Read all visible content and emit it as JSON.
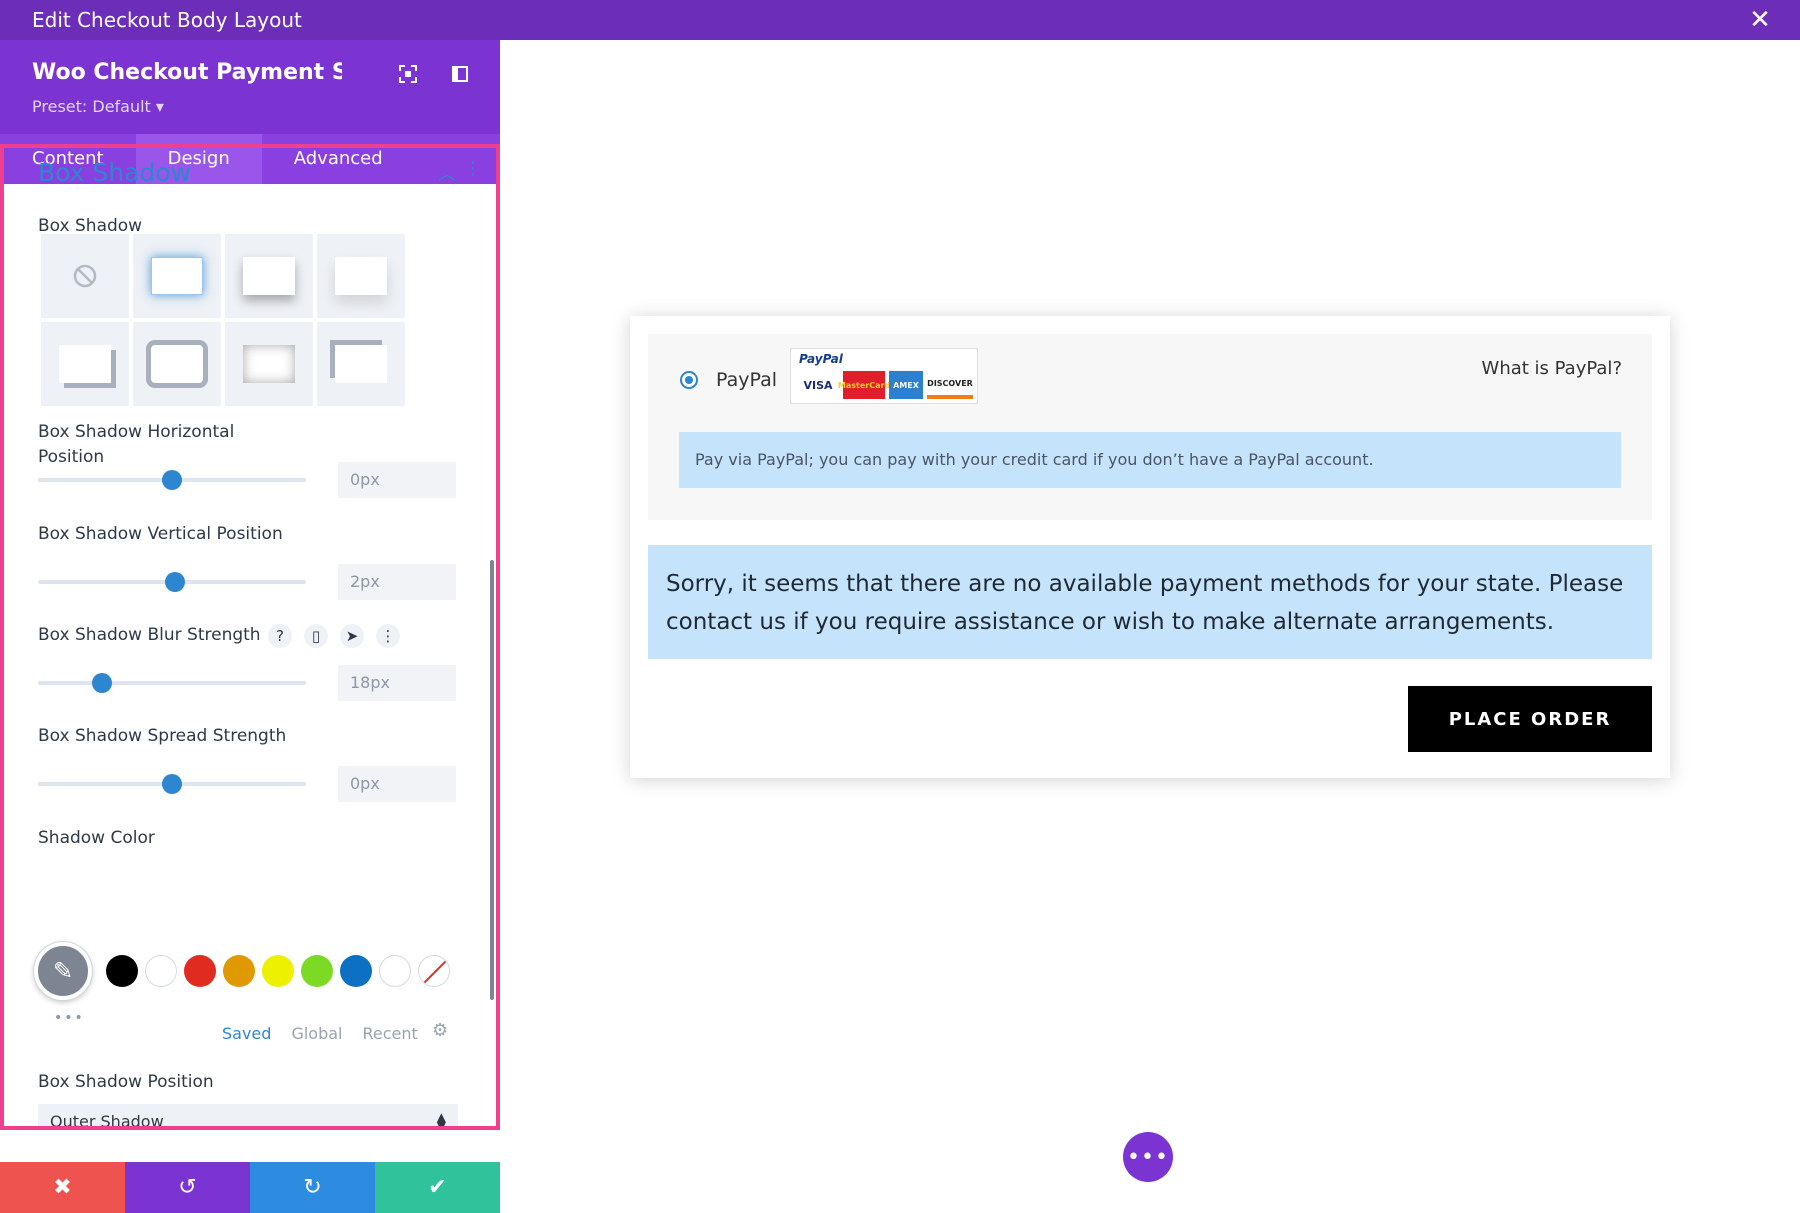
{
  "window": {
    "title": "Edit Checkout Body Layout"
  },
  "panel": {
    "module_title": "Woo Checkout Payment Se...",
    "preset": "Preset: Default ▾",
    "tabs": [
      {
        "label": "Content",
        "active": false
      },
      {
        "label": "Design",
        "active": true
      },
      {
        "label": "Advanced",
        "active": false
      }
    ],
    "section_title": "Box Shadow",
    "box_shadow_label": "Box Shadow",
    "horizontal": {
      "label": "Box Shadow Horizontal Position",
      "value": "0px",
      "slider_level": 0.5
    },
    "vertical": {
      "label": "Box Shadow Vertical Position",
      "value": "2px",
      "slider_level": 0.51
    },
    "blur": {
      "label": "Box Shadow Blur Strength",
      "value": "18px",
      "slider_level": 0.24
    },
    "spread": {
      "label": "Box Shadow Spread Strength",
      "value": "0px",
      "slider_level": 0.5
    },
    "shadow_color": {
      "label": "Shadow Color",
      "swatches": [
        "#000000",
        "#ffffff",
        "#e02b20",
        "#e09900",
        "#edf000",
        "#7cda24",
        "#0c71c3",
        "#ffffff"
      ],
      "tabs": [
        "Saved",
        "Global",
        "Recent"
      ],
      "active_tab": "Saved"
    },
    "position": {
      "label": "Box Shadow Position",
      "value": "Outer Shadow"
    }
  },
  "preview": {
    "payment_name": "PayPal",
    "paypal_logo": "PayPal",
    "card_brands": [
      "VISA",
      "MasterCard",
      "AMEX",
      "DISCOVER"
    ],
    "what_is": "What is PayPal?",
    "payment_desc": "Pay via PayPal; you can pay with your credit card if you don’t have a PayPal account.",
    "notice": "Sorry, it seems that there are no available payment methods for your state. Please contact us if you require assistance or wish to make alternate arrangements.",
    "order_button": "PLACE ORDER"
  },
  "colors": {
    "topbar": "#6c2eb9",
    "accent": "#2e86d0",
    "highlight_border": "#ef3f8f"
  }
}
